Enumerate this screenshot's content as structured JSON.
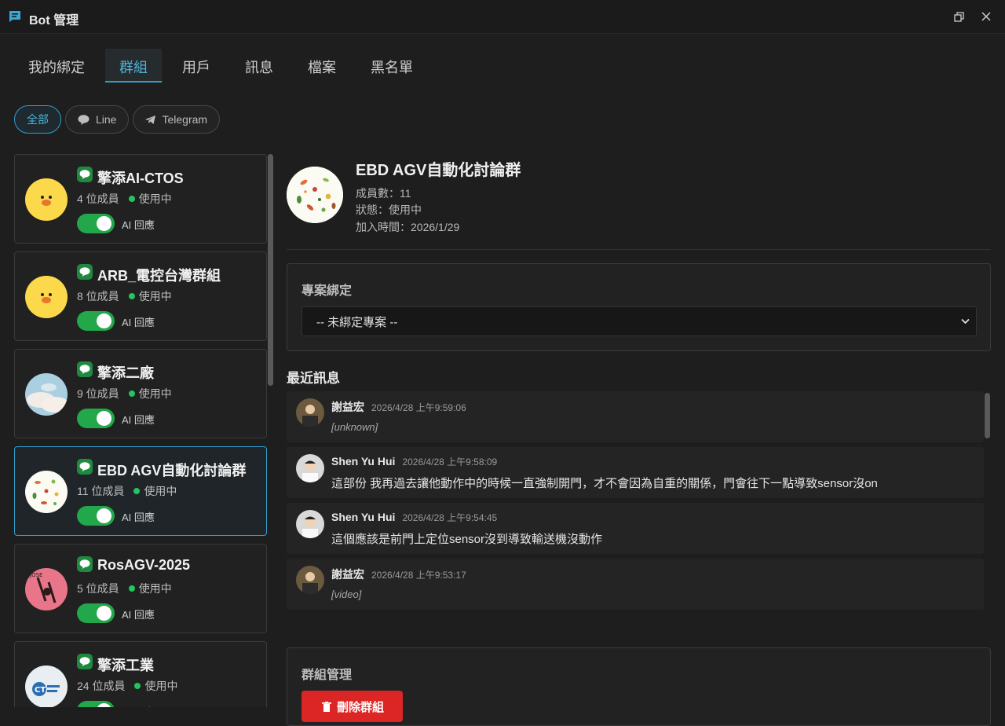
{
  "window": {
    "title": "Bot 管理",
    "icon": "chat-icon"
  },
  "tabs": [
    {
      "label": "我的綁定",
      "active": false
    },
    {
      "label": "群組",
      "active": true
    },
    {
      "label": "用戶",
      "active": false
    },
    {
      "label": "訊息",
      "active": false
    },
    {
      "label": "檔案",
      "active": false
    },
    {
      "label": "黑名單",
      "active": false
    }
  ],
  "filters": [
    {
      "label": "全部",
      "active": true
    },
    {
      "label": "Line",
      "icon": "line-icon"
    },
    {
      "label": "Telegram",
      "icon": "telegram-icon"
    }
  ],
  "groups": [
    {
      "name": "擎添AI-CTOS",
      "members": "4 位成員",
      "status": "使用中",
      "ai_label": "AI 回應",
      "ai_on": true,
      "avatar": "duck"
    },
    {
      "name": "ARB_電控台灣群組",
      "members": "8 位成員",
      "status": "使用中",
      "ai_label": "AI 回應",
      "ai_on": true,
      "avatar": "duck"
    },
    {
      "name": "擎添二廠",
      "members": "9 位成員",
      "status": "使用中",
      "ai_label": "AI 回應",
      "ai_on": true,
      "avatar": "sky"
    },
    {
      "name": "EBD AGV自動化討論群",
      "members": "11 位成員",
      "status": "使用中",
      "ai_label": "AI 回應",
      "ai_on": true,
      "avatar": "veg",
      "active": true
    },
    {
      "name": "RosAGV-2025",
      "members": "5 位成員",
      "status": "使用中",
      "ai_label": "AI 回應",
      "ai_on": true,
      "avatar": "pink"
    },
    {
      "name": "擎添工業",
      "members": "24 位成員",
      "status": "使用中",
      "ai_label": "AI 回應",
      "ai_on": true,
      "avatar": "logo"
    }
  ],
  "detail": {
    "name": "EBD AGV自動化討論群",
    "members": "成員數：11",
    "status": "狀態：使用中",
    "joined": "加入時間：2026/1/29",
    "project_title": "專案綁定",
    "project_select": "-- 未綁定專案 --",
    "recent_title": "最近訊息",
    "manage_title": "群組管理",
    "delete_label": "刪除群組"
  },
  "messages": [
    {
      "sender": "謝益宏",
      "time": "2026/4/28 上午9:59:06",
      "text": "[unknown]",
      "italic": true
    },
    {
      "sender": "Shen Yu Hui",
      "time": "2026/4/28 上午9:58:09",
      "text": "這部份 我再過去讓他動作中的時候一直強制開門，才不會因為自重的關係，門會往下一點導致sensor沒on",
      "italic": false
    },
    {
      "sender": "Shen Yu Hui",
      "time": "2026/4/28 上午9:54:45",
      "text": "這個應該是前門上定位sensor沒到導致輸送機沒動作",
      "italic": false
    },
    {
      "sender": "謝益宏",
      "time": "2026/4/28 上午9:53:17",
      "text": "[video]",
      "italic": true
    }
  ],
  "colors": {
    "accent": "#2f9fcf",
    "line_green": "#1f8a3f",
    "toggle_on": "#22a74a",
    "status_dot": "#22c55e",
    "danger": "#dc2626"
  }
}
